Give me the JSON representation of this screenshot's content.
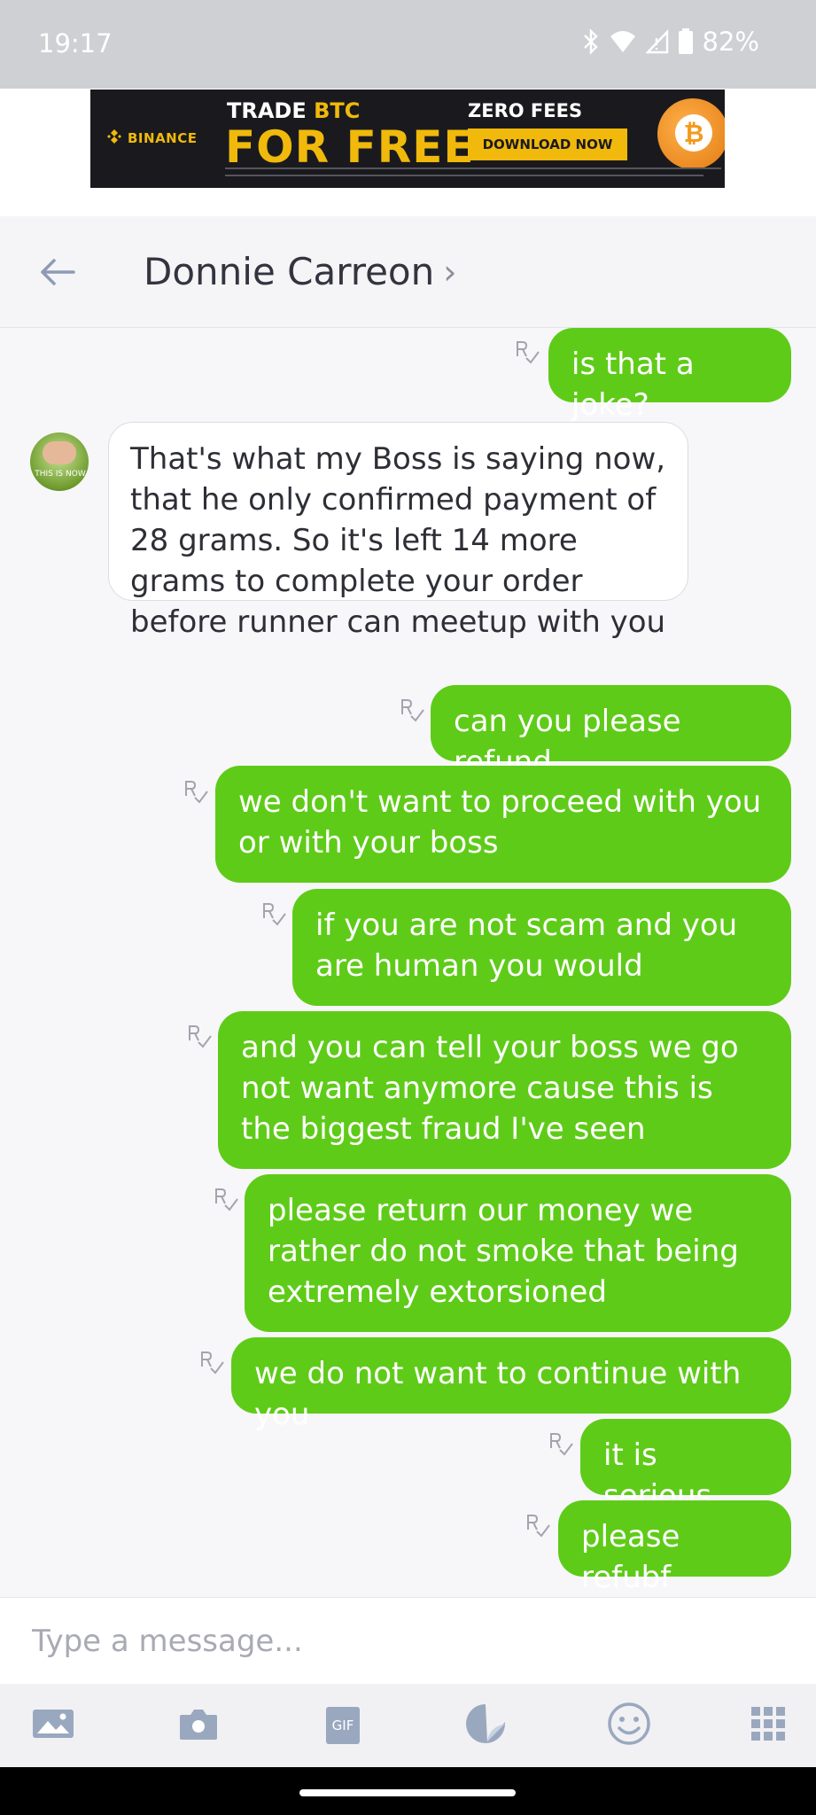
{
  "status_bar": {
    "time": "19:17",
    "battery": "82%"
  },
  "ad": {
    "brand": "BINANCE",
    "line1_prefix": "TRADE ",
    "line1_accent": "BTC",
    "line2": "FOR FREE",
    "zero_fees": "ZERO FEES",
    "cta": "DOWNLOAD NOW",
    "coin_symbol": "₿"
  },
  "header": {
    "contact_name": "Donnie Carreon",
    "chevron": "›"
  },
  "avatar": {
    "caption": "THIS IS NOW"
  },
  "messages": [
    {
      "direction": "out",
      "text": "is that a joke?"
    },
    {
      "direction": "in",
      "text": "That's what my Boss is saying now, that he only confirmed payment of 28 grams. So it's left 14 more grams to complete your order before runner can meetup with you"
    },
    {
      "direction": "out",
      "text": "can you please refund"
    },
    {
      "direction": "out",
      "text": "we don't want to proceed with you or with your boss"
    },
    {
      "direction": "out",
      "text": "if you are not scam and you are human you would"
    },
    {
      "direction": "out",
      "text": "and you can tell your boss we go not want anymore cause this is the biggest fraud I've seen"
    },
    {
      "direction": "out",
      "text": "please return our money we rather do not smoke that being extremely extorsioned"
    },
    {
      "direction": "out",
      "text": "we do not want to continue with you"
    },
    {
      "direction": "out",
      "text": "it is serious"
    },
    {
      "direction": "out",
      "text": "please refubf"
    }
  ],
  "composer": {
    "placeholder": "Type a message..."
  },
  "toolbar": {
    "gif_label": "GIF"
  },
  "colors": {
    "outgoing": "#5fcb19",
    "incoming": "#ffffff",
    "brand": "#f0b90b"
  }
}
